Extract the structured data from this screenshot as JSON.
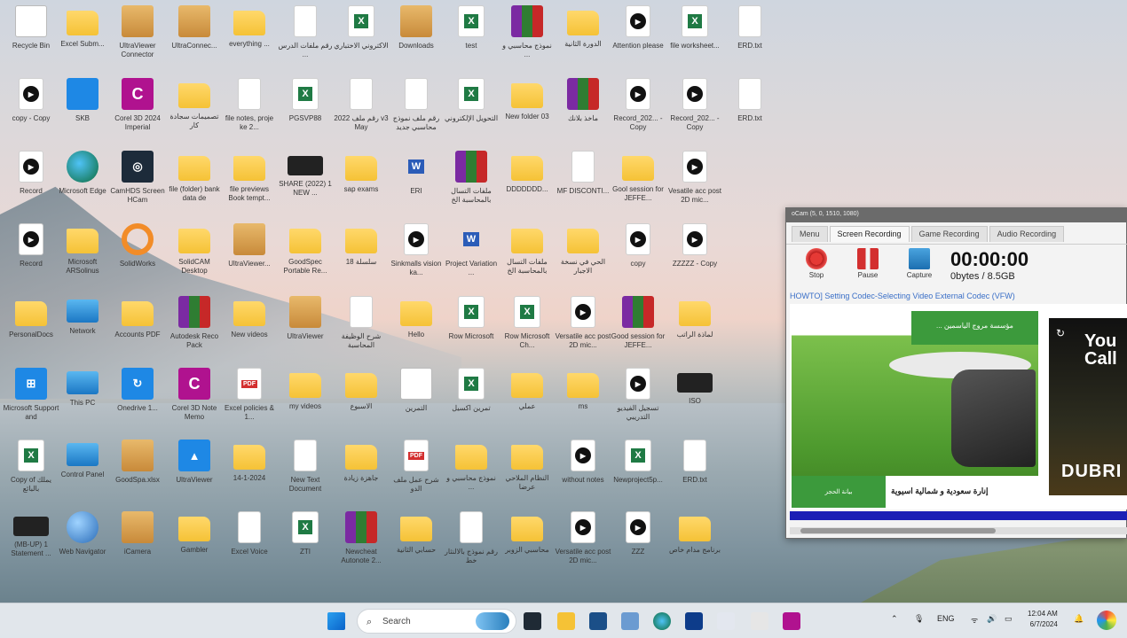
{
  "desktop": {
    "icons": [
      {
        "label": "Recycle Bin",
        "type": "gray",
        "glyph": "♻"
      },
      {
        "label": "Excel Subm...",
        "type": "folder",
        "glyph": ""
      },
      {
        "label": "UltraViewer Connector",
        "type": "box",
        "glyph": ""
      },
      {
        "label": "UltraConnec...",
        "type": "box",
        "glyph": ""
      },
      {
        "label": "everything ...",
        "type": "folder",
        "glyph": ""
      },
      {
        "label": "رقم ملفات الدرس ...",
        "type": "file",
        "glyph": ""
      },
      {
        "label": "الاكتروني الاختباري",
        "type": "excel",
        "glyph": "X"
      },
      {
        "label": "Downloads",
        "type": "box",
        "glyph": ""
      },
      {
        "label": "test",
        "type": "excel",
        "glyph": "X"
      },
      {
        "label": "نموذج محاسبي و ...",
        "type": "rar",
        "glyph": ""
      },
      {
        "label": "الدورة الثانية",
        "type": "folder",
        "glyph": ""
      },
      {
        "label": "Attention please",
        "type": "video",
        "glyph": "▶"
      },
      {
        "label": "file worksheet...",
        "type": "excel",
        "glyph": "X"
      },
      {
        "label": "ERD.txt",
        "type": "file",
        "glyph": ""
      },
      {
        "label": "copy - Copy",
        "type": "video",
        "glyph": "▶"
      },
      {
        "label": "SKB",
        "type": "blue",
        "glyph": ""
      },
      {
        "label": "Corel 3D 2024 Imperial",
        "type": "app",
        "glyph": "C"
      },
      {
        "label": "تصميمات سجادة كار",
        "type": "folder",
        "glyph": ""
      },
      {
        "label": "file notes, proje ke 2...",
        "type": "file",
        "glyph": ""
      },
      {
        "label": "PGSVP88",
        "type": "excel",
        "glyph": "X"
      },
      {
        "label": "رقم ملف 2022 v3 May",
        "type": "file",
        "glyph": ""
      },
      {
        "label": "رقم ملف نموذج محاسبي جديد",
        "type": "file",
        "glyph": ""
      },
      {
        "label": "التحويل الإلكتروني",
        "type": "excel",
        "glyph": "X"
      },
      {
        "label": "New folder 03",
        "type": "folder",
        "glyph": ""
      },
      {
        "label": "ماخذ بلانك",
        "type": "rar",
        "glyph": ""
      },
      {
        "label": "Record_202... - Copy",
        "type": "video",
        "glyph": "▶"
      },
      {
        "label": "Record_202... - Copy",
        "type": "video",
        "glyph": "▶"
      },
      {
        "label": "ERD.txt",
        "type": "file",
        "glyph": ""
      },
      {
        "label": "Record",
        "type": "video",
        "glyph": "▶"
      },
      {
        "label": "Microsoft Edge",
        "type": "edge",
        "glyph": ""
      },
      {
        "label": "CamHDS Screen HCam",
        "type": "dark",
        "glyph": "◎"
      },
      {
        "label": "file (folder) bank data de",
        "type": "folder",
        "glyph": ""
      },
      {
        "label": "file previews Book tempt...",
        "type": "folder",
        "glyph": ""
      },
      {
        "label": "SHARE (2022) 1 NEW ...",
        "type": "thumb",
        "glyph": ""
      },
      {
        "label": "sap exams",
        "type": "folder",
        "glyph": ""
      },
      {
        "label": "ERI",
        "type": "word",
        "glyph": "W"
      },
      {
        "label": "ملفات التسال بالمحاسبة الخ",
        "type": "rar",
        "glyph": ""
      },
      {
        "label": "DDDDDDD...",
        "type": "folder",
        "glyph": ""
      },
      {
        "label": "MF DISCONTI...",
        "type": "file",
        "glyph": ""
      },
      {
        "label": "Gool session for JEFFE...",
        "type": "folder",
        "glyph": ""
      },
      {
        "label": "Vesatile acc post 2D mic...",
        "type": "video",
        "glyph": "▶"
      },
      {
        "label": "Record",
        "type": "video",
        "glyph": "▶"
      },
      {
        "label": "Microsoft ARSolinus",
        "type": "folder",
        "glyph": ""
      },
      {
        "label": "SolidWorks",
        "type": "orange",
        "glyph": ""
      },
      {
        "label": "SolidCAM Desktop",
        "type": "folder",
        "glyph": ""
      },
      {
        "label": "UltraViewer...",
        "type": "box",
        "glyph": ""
      },
      {
        "label": "GoodSpec Portable Re...",
        "type": "folder",
        "glyph": ""
      },
      {
        "label": "سلسلة 18",
        "type": "folder",
        "glyph": ""
      },
      {
        "label": "Sinkmalls vision ka...",
        "type": "video",
        "glyph": "▶"
      },
      {
        "label": "Project Variation ...",
        "type": "word",
        "glyph": "W"
      },
      {
        "label": "ملفات التسال بالمحاسبة الخ",
        "type": "folder",
        "glyph": ""
      },
      {
        "label": "الحي في نسخة الاجبار",
        "type": "folder",
        "glyph": ""
      },
      {
        "label": "copy",
        "type": "video",
        "glyph": "▶"
      },
      {
        "label": "ZZZZZ - Copy",
        "type": "video",
        "glyph": "▶"
      },
      {
        "label": "PersonalDocs",
        "type": "folder",
        "glyph": ""
      },
      {
        "label": "Network",
        "type": "monitor",
        "glyph": ""
      },
      {
        "label": "Accounts PDF",
        "type": "folder",
        "glyph": ""
      },
      {
        "label": "Autodesk Reco Pack",
        "type": "rar",
        "glyph": ""
      },
      {
        "label": "New videos",
        "type": "folder",
        "glyph": ""
      },
      {
        "label": "UltraViewer",
        "type": "box",
        "glyph": ""
      },
      {
        "label": "شرح الوظيفة المحاسبة",
        "type": "file",
        "glyph": ""
      },
      {
        "label": "Hello",
        "type": "folder",
        "glyph": ""
      },
      {
        "label": "Row Microsoft",
        "type": "excel",
        "glyph": "X"
      },
      {
        "label": "Row Microsoft Ch...",
        "type": "excel",
        "glyph": "X"
      },
      {
        "label": "Versatile acc post 2D mic...",
        "type": "video",
        "glyph": "▶"
      },
      {
        "label": "Good session for JEFFE...",
        "type": "rar",
        "glyph": ""
      },
      {
        "label": "لماذة الراتب",
        "type": "folder",
        "glyph": ""
      },
      {
        "label": "Microsoft Support and",
        "type": "blue",
        "glyph": "⊞"
      },
      {
        "label": "This PC",
        "type": "monitor",
        "glyph": ""
      },
      {
        "label": "Onedrive 1...",
        "type": "blue",
        "glyph": "↻"
      },
      {
        "label": "Corel 3D Note Memo",
        "type": "app",
        "glyph": "C"
      },
      {
        "label": "Excel policies & 1...",
        "type": "pdf",
        "glyph": "PDF"
      },
      {
        "label": "my videos",
        "type": "folder",
        "glyph": ""
      },
      {
        "label": "الاسبوع",
        "type": "folder",
        "glyph": ""
      },
      {
        "label": "التمرين",
        "type": "gray",
        "glyph": "⚙"
      },
      {
        "label": "تمرين اكسيل",
        "type": "excel",
        "glyph": "X"
      },
      {
        "label": "عملي",
        "type": "folder",
        "glyph": ""
      },
      {
        "label": "ms",
        "type": "folder",
        "glyph": ""
      },
      {
        "label": "تسجيل الفيديو التدريبي",
        "type": "video",
        "glyph": "▶"
      },
      {
        "label": "ISO",
        "type": "thumb",
        "glyph": ""
      },
      {
        "label": "Copy of يملك بالبائع",
        "type": "excel",
        "glyph": "X"
      },
      {
        "label": "Control Panel",
        "type": "monitor",
        "glyph": ""
      },
      {
        "label": "GoodSpa.xlsx",
        "type": "box",
        "glyph": ""
      },
      {
        "label": "UltraViewer",
        "type": "blue",
        "glyph": "▲"
      },
      {
        "label": "14-1-2024",
        "type": "folder",
        "glyph": ""
      },
      {
        "label": "New Text Document",
        "type": "file",
        "glyph": ""
      },
      {
        "label": "جاهزة زيادة",
        "type": "folder",
        "glyph": ""
      },
      {
        "label": "شرح عمل ملف الدو",
        "type": "pdf",
        "glyph": "PDF"
      },
      {
        "label": "نموذج محاسبي و ...",
        "type": "folder",
        "glyph": ""
      },
      {
        "label": "النظام الملاحي عرضا",
        "type": "folder",
        "glyph": ""
      },
      {
        "label": "without notes",
        "type": "video",
        "glyph": "▶"
      },
      {
        "label": "Newproject5p...",
        "type": "excel",
        "glyph": "X"
      },
      {
        "label": "ERD.txt",
        "type": "file",
        "glyph": ""
      },
      {
        "label": "(MB-UP) 1 Statement ...",
        "type": "thumb",
        "glyph": ""
      },
      {
        "label": "Web Navigator",
        "type": "globe",
        "glyph": ""
      },
      {
        "label": "iCamera",
        "type": "box",
        "glyph": ""
      },
      {
        "label": "Gambler",
        "type": "folder",
        "glyph": ""
      },
      {
        "label": "Excel Voice",
        "type": "file",
        "glyph": ""
      },
      {
        "label": "ZTI",
        "type": "excel",
        "glyph": "X"
      },
      {
        "label": "Newcheat Autonote 2...",
        "type": "rar",
        "glyph": ""
      },
      {
        "label": "حسابي الثانية",
        "type": "folder",
        "glyph": ""
      },
      {
        "label": "رقم نموذج بالالنثار خط",
        "type": "file",
        "glyph": ""
      },
      {
        "label": "محاسبي الزوبر",
        "type": "folder",
        "glyph": ""
      },
      {
        "label": "Versatile acc post 2D mic...",
        "type": "video",
        "glyph": "▶"
      },
      {
        "label": "ZZZ",
        "type": "video",
        "glyph": "▶"
      },
      {
        "label": "برنامج مدام خاص",
        "type": "folder",
        "glyph": ""
      }
    ]
  },
  "recorder": {
    "title": "oCam (5, 0, 1510, 1080)",
    "tabs": [
      "Menu",
      "Screen Recording",
      "Game Recording",
      "Audio Recording"
    ],
    "tools": {
      "stop": "Stop",
      "pause": "Pause",
      "capture": "Capture"
    },
    "timer": "00:00:00",
    "bytes": "0bytes / 8.5GB",
    "link": "HOWTO] Setting Codec-Selecting Video External Codec (VFW)",
    "preview": {
      "banner": "... مؤسسة مروج الياسمين",
      "button": "بيانة الحجز",
      "caption": "إنارة سعودية و شمالية اسيوية",
      "ad_title": "You Call",
      "ad_logo": "DUBRI"
    }
  },
  "taskbar": {
    "search_placeholder": "Search",
    "tray_lang": "ENG",
    "time": "12:04 AM",
    "date": "6/7/2024"
  },
  "colors": {
    "accent": "#0a63c9",
    "folder": "#f5c236",
    "excel": "#1f7a44",
    "word": "#2b5cb8",
    "pdf": "#d32f2f",
    "lawn_green": "#3c9a3c",
    "progress_blue": "#1b1fb5"
  }
}
